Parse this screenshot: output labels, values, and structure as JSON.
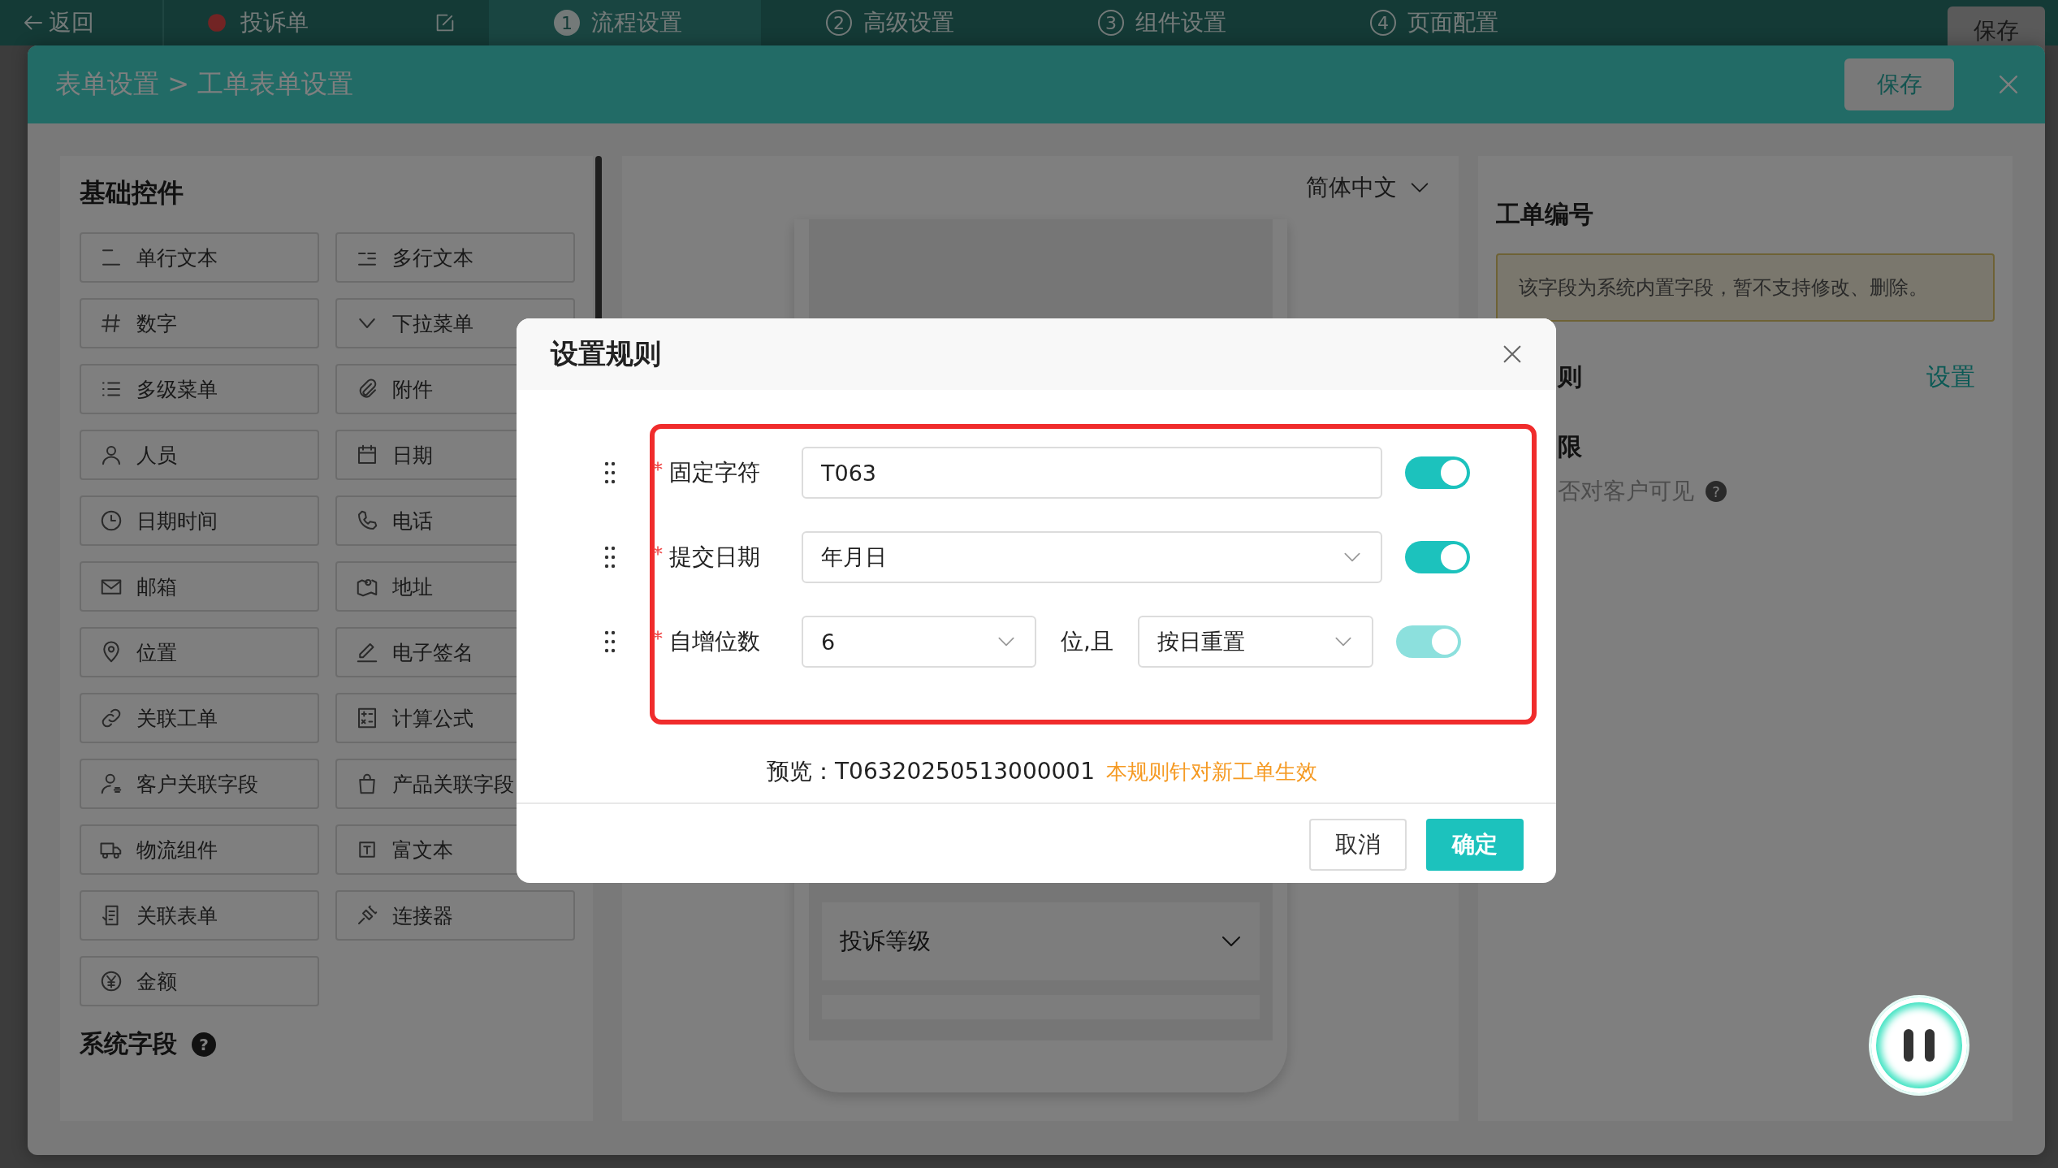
{
  "top_bar": {
    "back": "返回",
    "title": "投诉单",
    "steps": [
      {
        "number": "1",
        "label": "流程设置",
        "selected": true
      },
      {
        "number": "2",
        "label": "高级设置",
        "selected": false
      },
      {
        "number": "3",
        "label": "组件设置",
        "selected": false
      },
      {
        "number": "4",
        "label": "页面配置",
        "selected": false
      }
    ],
    "save": "保存"
  },
  "drawer": {
    "breadcrumb": "表单设置 > 工单表单设置",
    "save": "保存"
  },
  "widgets": {
    "title": "基础控件",
    "items": [
      {
        "label": "单行文本",
        "kind": "text"
      },
      {
        "label": "多行文本",
        "kind": "textarea"
      },
      {
        "label": "数字",
        "kind": "number"
      },
      {
        "label": "下拉菜单",
        "kind": "dropdown"
      },
      {
        "label": "多级菜单",
        "kind": "list"
      },
      {
        "label": "附件",
        "kind": "attachment"
      },
      {
        "label": "人员",
        "kind": "person"
      },
      {
        "label": "日期",
        "kind": "date"
      },
      {
        "label": "日期时间",
        "kind": "clock"
      },
      {
        "label": "电话",
        "kind": "phone"
      },
      {
        "label": "邮箱",
        "kind": "email"
      },
      {
        "label": "地址",
        "kind": "address"
      },
      {
        "label": "位置",
        "kind": "location"
      },
      {
        "label": "电子签名",
        "kind": "signature"
      },
      {
        "label": "关联工单",
        "kind": "link"
      },
      {
        "label": "计算公式",
        "kind": "formula"
      },
      {
        "label": "客户关联字段",
        "kind": "customer"
      },
      {
        "label": "产品关联字段",
        "kind": "product"
      },
      {
        "label": "物流组件",
        "kind": "logistics"
      },
      {
        "label": "富文本",
        "kind": "richtext"
      },
      {
        "label": "关联表单",
        "kind": "form"
      },
      {
        "label": "连接器",
        "kind": "connector"
      },
      {
        "label": "金额",
        "kind": "money"
      }
    ],
    "system_title": "系统字段",
    "system_help": "?"
  },
  "preview": {
    "language": "简体中文",
    "fields": [
      {
        "label": "投诉等级"
      }
    ]
  },
  "properties": {
    "title": "工单编号",
    "notice": "该字段为系统内置字段，暂不支持修改、删除。",
    "rule_label": "则",
    "rule_action": "设置",
    "permission_label": "限",
    "visibility_label": "否对客户可见",
    "visibility_help": "?"
  },
  "modal": {
    "title": "设置规则",
    "rules": [
      {
        "label": "固定字符",
        "required": true,
        "kind": "input",
        "value": "T063",
        "on": true,
        "disabled": false
      },
      {
        "label": "提交日期",
        "required": true,
        "kind": "select",
        "value": "年月日",
        "on": true,
        "disabled": false
      },
      {
        "label": "自增位数",
        "required": true,
        "kind": "pair",
        "value": "6",
        "joiner": "位,且",
        "value_2": "按日重置",
        "on": true,
        "disabled": true
      }
    ],
    "preview": "预览：T06320250513000001",
    "notice": "本规则针对新工单生效",
    "buttons": [
      {
        "label": "取消",
        "kind": "default"
      },
      {
        "label": "确定",
        "kind": "primary"
      }
    ]
  }
}
